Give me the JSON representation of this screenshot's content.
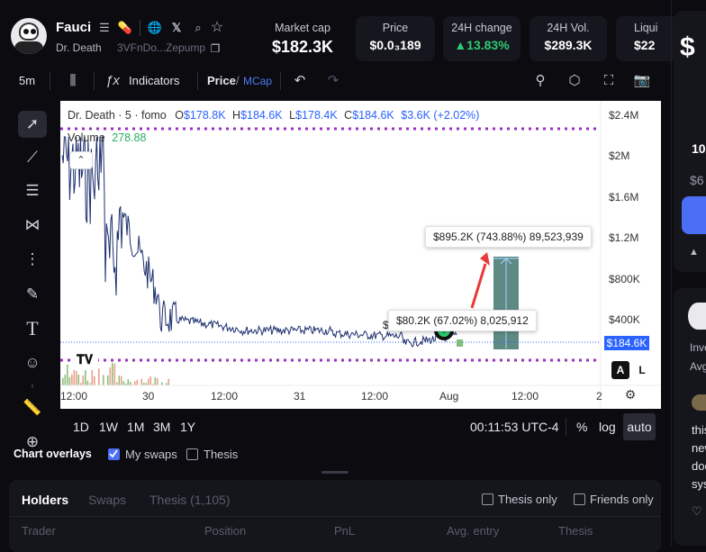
{
  "token": {
    "name": "Fauci",
    "creator": "Dr. Death",
    "address": "3VFnDo...Zepump"
  },
  "stats": [
    {
      "label": "Market cap",
      "value": "$182.3K"
    },
    {
      "label": "Price",
      "value": "$0.0₃189"
    },
    {
      "label": "24H change",
      "value": "▲13.83%"
    },
    {
      "label": "24H Vol.",
      "value": "$289.3K"
    },
    {
      "label": "Liqui",
      "value": "$22"
    }
  ],
  "toolbar": {
    "interval": "5m",
    "indicators_label": "Indicators",
    "price_label": "Price",
    "separator": "/",
    "mcap_label": "MCap"
  },
  "chart": {
    "legend_title": "Dr. Death · 5 · fomo",
    "o_label": "O",
    "o_val": "$178.8K",
    "h_label": "H",
    "h_val": "$184.6K",
    "l_label": "L",
    "l_val": "$178.4K",
    "c_label": "C",
    "c_val": "$184.6K",
    "change": "$3.6K (+2.02%)",
    "volume_label": "Volume",
    "volume_val": "278.88",
    "yticks": [
      "$2.4M",
      "$2M",
      "$1.6M",
      "$1.2M",
      "$800K",
      "$400K"
    ],
    "xticks": [
      "12:00",
      "30",
      "12:00",
      "31",
      "12:00",
      "Aug",
      "12:00",
      "2"
    ],
    "current_price_tag": "$184.6K",
    "tooltip_top": "$895.2K (743.88%) 89,523,939",
    "tooltip_mid": "$80.2K (67.02%) 8,025,912",
    "tooltip_mid_prefix": "$",
    "btn_a": "A",
    "btn_l": "L",
    "colors": {
      "line": "#1c2e6e",
      "volume": "#8fbf7a",
      "dotted": "#9b30c0",
      "measure": "#5f8a84"
    }
  },
  "below_chart": {
    "ranges": [
      "1D",
      "1W",
      "1M",
      "3M",
      "1Y"
    ],
    "time": "00:11:53 UTC-4",
    "pct": "%",
    "log": "log",
    "auto": "auto"
  },
  "overlays": {
    "title": "Chart overlays",
    "my_swaps": "My swaps",
    "thesis": "Thesis"
  },
  "holders": {
    "tabs": [
      "Holders",
      "Swaps",
      "Thesis (1,105)"
    ],
    "thesis_only": "Thesis only",
    "friends_only": "Friends only",
    "columns": [
      "Trader",
      "Position",
      "PnL",
      "Avg. entry",
      "Thesis"
    ]
  },
  "right_panel": {
    "big_symbol": "$",
    "pct": "10",
    "amount": "$6",
    "warn": "▲",
    "inve": "Inve",
    "avg": "Avg",
    "lines": [
      "this",
      "new",
      "doc",
      "sys"
    ]
  }
}
